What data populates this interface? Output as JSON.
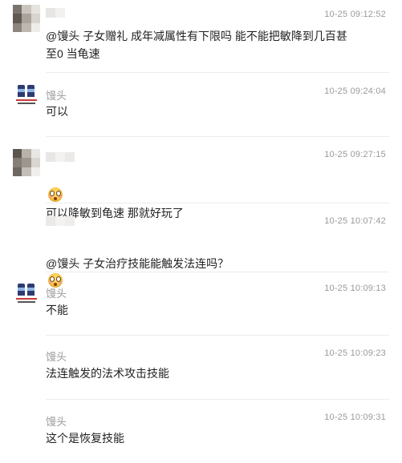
{
  "messages": [
    {
      "id": "m1",
      "avatar": "pixelated-avatar",
      "name": "",
      "time": "10-25 09:12:52",
      "text": "@馒头 子女赠礼   成年减属性有下限吗   能不能把敏降到几百甚\n至0    当龟速"
    },
    {
      "id": "m2",
      "avatar": "robot-avatar",
      "name": "馒头",
      "time": "10-25 09:24:04",
      "text": "可以"
    },
    {
      "id": "m3",
      "avatar": "pixelated-avatar",
      "name": "",
      "time": "10-25 09:27:15",
      "text_prefix_icon": "flushed-face-emoji",
      "text": "可以降敏到龟速  那就好玩了"
    },
    {
      "id": "m4",
      "avatar": "none",
      "name": "",
      "time": "10-25 10:07:42",
      "text": "@馒头 子女治疗技能能触发法连吗？",
      "text_suffix_icon": "flushed-face-emoji"
    },
    {
      "id": "m5",
      "avatar": "robot-avatar",
      "name": "馒头",
      "time": "10-25 10:09:13",
      "text": "不能"
    },
    {
      "id": "m6",
      "avatar": "none",
      "name": "馒头",
      "time": "10-25 10:09:23",
      "text": "法连触发的法术攻击技能"
    },
    {
      "id": "m7",
      "avatar": "none",
      "name": "馒头",
      "time": "10-25 10:09:31",
      "text": "这个是恢复技能"
    }
  ]
}
